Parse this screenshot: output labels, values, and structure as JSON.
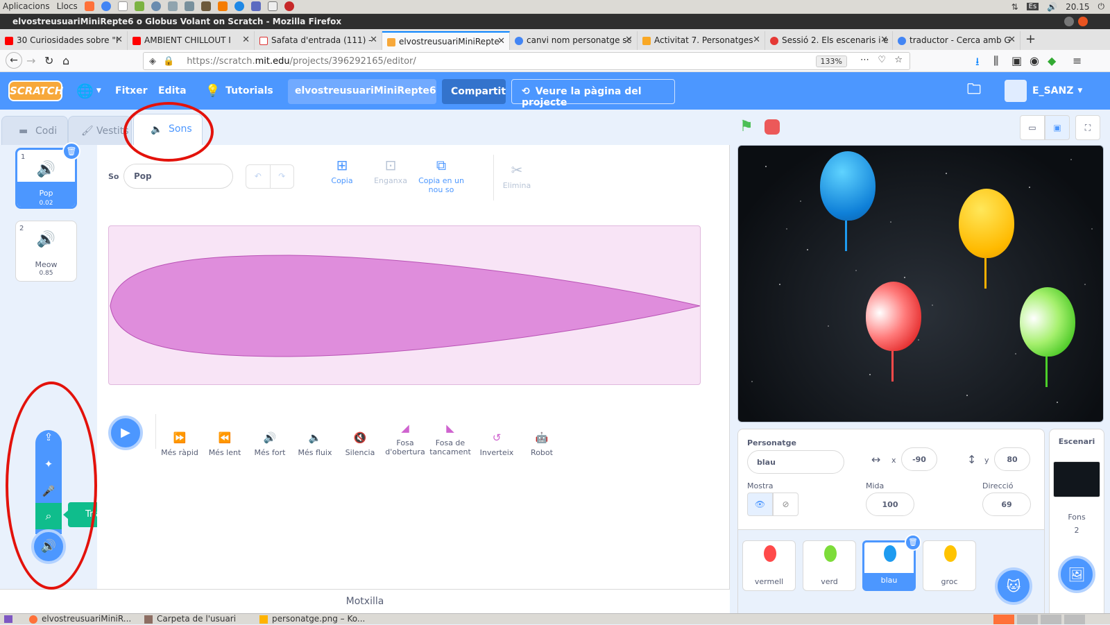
{
  "os": {
    "apps": "Aplicacions",
    "places": "Llocs",
    "keyboard": "Es",
    "clock": "20.15"
  },
  "window": {
    "title": "elvostreusuariMiniRepte6 o Globus Volant on Scratch - Mozilla Firefox"
  },
  "browser_tabs": [
    {
      "label": "30 Curiosidades sobre \"I"
    },
    {
      "label": "AMBIENT CHILLOUT I"
    },
    {
      "label": "Safata d'entrada (111) -"
    },
    {
      "label": "elvostreusuariMiniRepte"
    },
    {
      "label": "canvi nom personatge sc"
    },
    {
      "label": "Activitat 7. Personatges"
    },
    {
      "label": "Sessió 2. Els escenaris i e"
    },
    {
      "label": "traductor - Cerca amb G"
    }
  ],
  "new_tab": "+",
  "url": {
    "proto": "https://scratch.",
    "domain": "mit.edu",
    "path": "/projects/396292165/editor/"
  },
  "zoom": "133%",
  "menu": {
    "logo": "SCRATCH",
    "file": "Fitxer",
    "edit": "Edita",
    "tutorials": "Tutorials",
    "project_title": "elvostreusuariMiniRepte6 ...",
    "share": "Compartit",
    "see_project": "Veure la pàgina del projecte",
    "username": "E_SANZ"
  },
  "editor_tabs": {
    "code": "Codi",
    "costumes": "Vestits",
    "sounds": "Sons"
  },
  "sounds": [
    {
      "num": "1",
      "name": "Pop",
      "duration": "0.02"
    },
    {
      "num": "2",
      "name": "Meow",
      "duration": "0.85"
    }
  ],
  "sound_editor": {
    "label": "So",
    "name_value": "Pop",
    "tools": {
      "copy": "Copia",
      "paste": "Enganxa",
      "copy_new": "Copia en un nou so",
      "delete": "Elimina"
    },
    "effects": [
      "Més ràpid",
      "Més lent",
      "Més fort",
      "Més fluix",
      "Silencia",
      "Fosa d'obertura",
      "Fosa de tancament",
      "Inverteix",
      "Robot"
    ]
  },
  "add_sound_tooltip": "Tria un so",
  "backpack": "Motxilla",
  "sprite_info": {
    "sprite_label": "Personatge",
    "sprite_name": "blau",
    "x_label": "x",
    "x": "-90",
    "y_label": "y",
    "y": "80",
    "show_label": "Mostra",
    "size_label": "Mida",
    "size": "100",
    "direction_label": "Direcció",
    "direction": "69"
  },
  "sprites": [
    {
      "name": "vermell",
      "color": "#ff4a4a"
    },
    {
      "name": "verd",
      "color": "#7ddc3a"
    },
    {
      "name": "blau",
      "color": "#1e9bf0"
    },
    {
      "name": "groc",
      "color": "#ffc300"
    }
  ],
  "stage_panel": {
    "title": "Escenari",
    "backdrops_label": "Fons",
    "backdrops_count": "2"
  },
  "taskbar": [
    {
      "label": "elvostreusuariMiniR..."
    },
    {
      "label": "Carpeta de l'usuari"
    },
    {
      "label": "personatge.png – Ko..."
    }
  ],
  "colors": {
    "scratch_blue": "#4c97ff",
    "sound_purple": "#cf63cf",
    "annotation_red": "#e3120b"
  }
}
